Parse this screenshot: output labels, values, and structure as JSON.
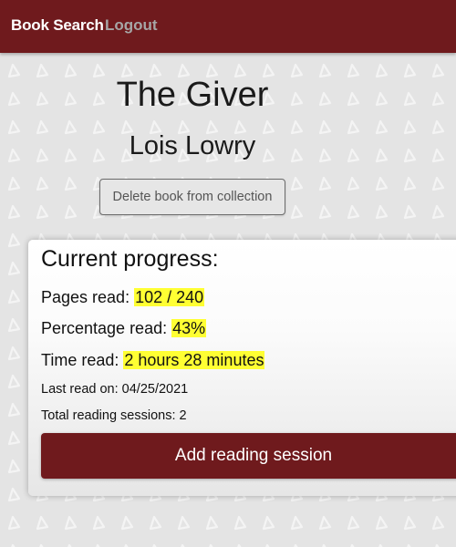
{
  "nav": {
    "brand": "Book Search",
    "logout": "Logout"
  },
  "book": {
    "title": "The Giver",
    "author": "Lois Lowry",
    "delete_label": "Delete book from collection"
  },
  "progress": {
    "heading": "Current progress:",
    "pages_label": "Pages read:",
    "pages_value": "102 / 240",
    "percentage_label": "Percentage read:",
    "percentage_value": "43%",
    "time_label": "Time read:",
    "time_value": "2 hours 28 minutes",
    "last_read": "Last read on: 04/25/2021",
    "sessions": "Total reading sessions: 2",
    "add_label": "Add reading session"
  },
  "colors": {
    "navbar": "#6f1a1d",
    "button": "#6f1a1d",
    "highlight": "#ffff33",
    "background": "#e4e4e4"
  }
}
